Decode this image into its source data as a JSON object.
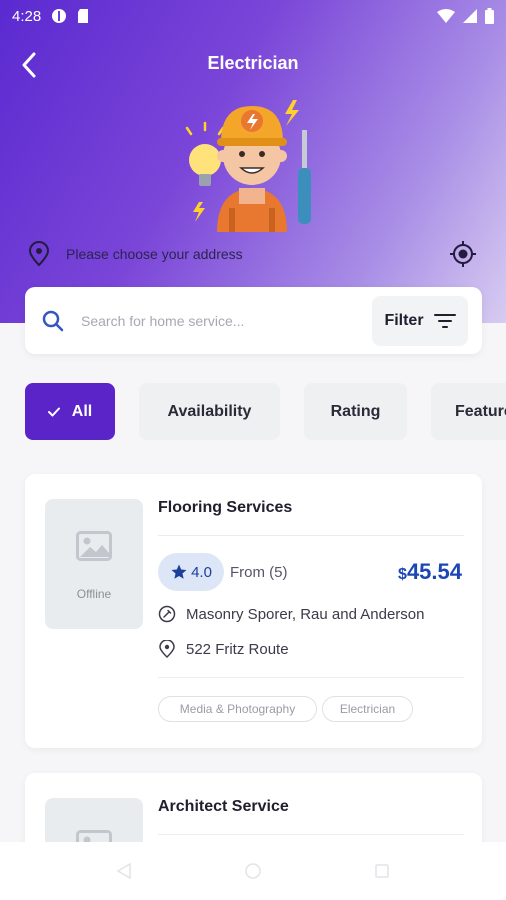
{
  "status_bar": {
    "time": "4:28"
  },
  "header": {
    "title": "Electrician",
    "address_placeholder": "Please choose your address"
  },
  "search": {
    "placeholder": "Search for home service...",
    "filter_label": "Filter"
  },
  "chips": [
    {
      "label": "All",
      "active": true
    },
    {
      "label": "Availability",
      "active": false
    },
    {
      "label": "Rating",
      "active": false
    },
    {
      "label": "Featured",
      "active": false
    }
  ],
  "services": [
    {
      "title": "Flooring Services",
      "status": "Offline",
      "rating": "4.0",
      "reviews": "From (5)",
      "currency": "$",
      "price": "45.54",
      "provider": "Masonry Sporer, Rau and Anderson",
      "address": "522 Fritz Route",
      "tags": [
        "Media & Photography",
        "Electrician"
      ]
    },
    {
      "title": "Architect Service"
    }
  ],
  "colors": {
    "accent": "#5a24c9",
    "header_gradient_start": "#5b2ad0",
    "header_gradient_end": "#d7ccf1",
    "price": "#1b46b6",
    "rating_pill": "#dde6f7"
  },
  "icons": [
    "back-arrow-icon",
    "location-pin-icon",
    "locate-target-icon",
    "search-icon",
    "filter-icon",
    "check-icon",
    "image-placeholder-icon",
    "star-icon",
    "provider-icon",
    "nav-back-icon",
    "nav-home-icon",
    "nav-recents-icon"
  ]
}
